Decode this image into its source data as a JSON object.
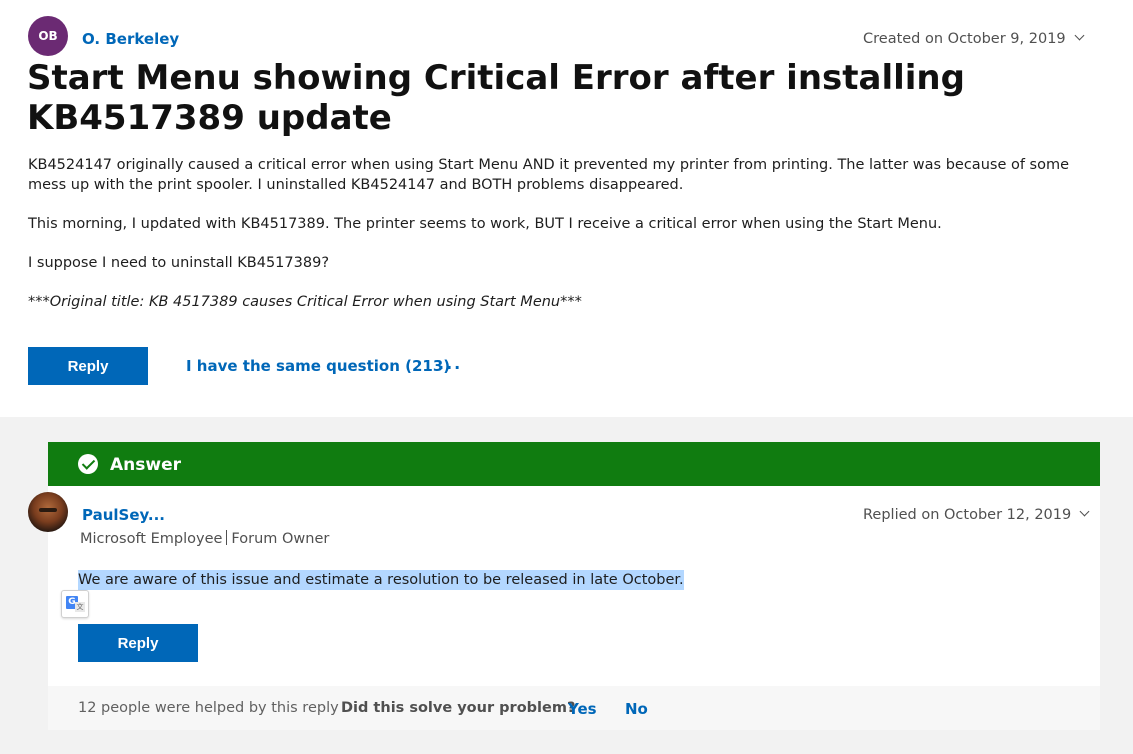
{
  "question": {
    "author_initials": "OB",
    "author_name": "O. Berkeley",
    "created": "Created on October 9, 2019",
    "title": "Start Menu showing Critical Error after installing KB4517389 update",
    "paragraphs": [
      "KB4524147 originally caused a critical error when using Start Menu AND it prevented my printer from printing. The latter was because of some mess up with the print spooler. I uninstalled KB4524147 and BOTH problems disappeared.",
      "This morning, I updated with KB4517389. The printer seems to work, BUT I receive a critical error when using the Start Menu.",
      "I suppose I need to uninstall KB4517389?",
      "***Original title: KB 4517389 causes Critical Error when using Start Menu***"
    ],
    "reply_label": "Reply",
    "same_question_label": "I have the same question (213)",
    "more_label": "···"
  },
  "answer": {
    "header_label": "Answer",
    "author_name": "PaulSey...",
    "role_left": "Microsoft Employee",
    "role_right": "Forum Owner",
    "replied": "Replied on October 12, 2019",
    "text": "We are aware of this issue and estimate a resolution to be released in late October.",
    "translate_glyph": "G",
    "translate_glyph2": "文",
    "reply_label": "Reply",
    "helped_text": "12 people were helped by this reply",
    "separator": "·",
    "solve_question": "Did this solve your problem?",
    "yes_label": "Yes",
    "no_label": "No"
  },
  "colors": {
    "accent": "#0067b8",
    "answer_green": "#107c10",
    "avatar_purple": "#6b2a73",
    "selection": "#b3d7ff"
  },
  "icons": [
    "chevron-down-icon",
    "check-circle-icon",
    "translate-icon"
  ]
}
